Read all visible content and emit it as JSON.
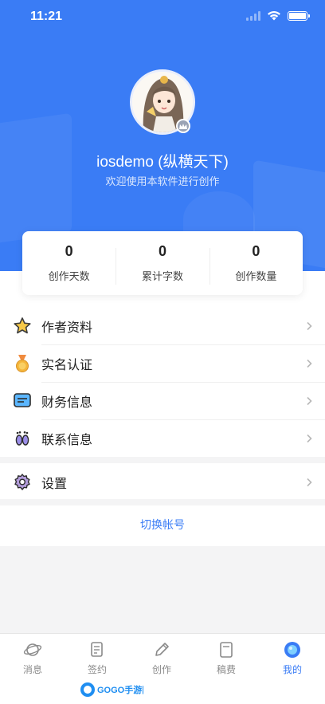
{
  "status_bar": {
    "time": "11:21"
  },
  "profile": {
    "username": "iosdemo (纵横天下)",
    "tagline": "欢迎使用本软件进行创作"
  },
  "stats": [
    {
      "value": "0",
      "label": "创作天数"
    },
    {
      "value": "0",
      "label": "累计字数"
    },
    {
      "value": "0",
      "label": "创作数量"
    }
  ],
  "menu": [
    {
      "label": "作者资料",
      "icon": "star-icon"
    },
    {
      "label": "实名认证",
      "icon": "medal-icon"
    },
    {
      "label": "财务信息",
      "icon": "message-card-icon"
    },
    {
      "label": "联系信息",
      "icon": "footprints-icon"
    },
    {
      "label": "设置",
      "icon": "gear-icon"
    }
  ],
  "switch_account": "切换帐号",
  "tabbar": [
    {
      "label": "消息",
      "icon": "planet-icon",
      "active": false
    },
    {
      "label": "签约",
      "icon": "contract-icon",
      "active": false
    },
    {
      "label": "创作",
      "icon": "pencil-icon",
      "active": false
    },
    {
      "label": "稿费",
      "icon": "book-icon",
      "active": false
    },
    {
      "label": "我的",
      "icon": "profile-circle-icon",
      "active": true
    }
  ],
  "colors": {
    "accent": "#3a7cf5",
    "header_bg": "#3a7cf5",
    "text": "#222222",
    "muted": "#8a8a8a"
  },
  "watermark": {
    "text": "GOGO手游网"
  }
}
